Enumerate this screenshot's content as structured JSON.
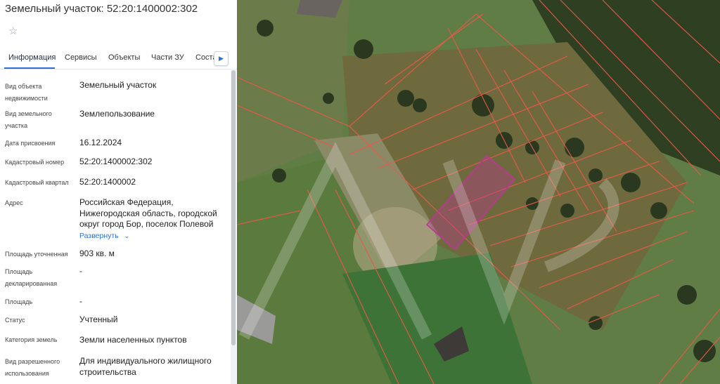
{
  "panel": {
    "title": "Земельный участок: 52:20:1400002:302",
    "tabs": [
      "Информация",
      "Сервисы",
      "Объекты",
      "Части ЗУ",
      "Соста"
    ],
    "fields": [
      {
        "label": "Вид объекта недвижимости",
        "value": "Земельный участок"
      },
      {
        "label": "Вид земельного участка",
        "value": "Землепользование"
      },
      {
        "label": "Дата присвоения",
        "value": "16.12.2024"
      },
      {
        "label": "Кадастровый номер",
        "value": "52:20:1400002:302"
      },
      {
        "label": "Кадастровый квартал",
        "value": "52:20:1400002"
      },
      {
        "label": "Адрес",
        "value": "Российская Федерация, Нижегородская область, городской округ город Бор, поселок Полевой"
      },
      {
        "label": "Площадь уточненная",
        "value": "903 кв. м"
      },
      {
        "label": "Площадь декларированная",
        "value": "-"
      },
      {
        "label": "Площадь",
        "value": "-"
      },
      {
        "label": "Статус",
        "value": "Учтенный"
      },
      {
        "label": "Категория земель",
        "value": "Земли населенных пунктов"
      },
      {
        "label": "Вид разрешенного использования",
        "value": "Для индивидуального жилищного строительства"
      }
    ],
    "expand_label": "Развернуть"
  },
  "colors": {
    "accent": "#2e6fd8",
    "parcel_boundary": "#e8594a",
    "selected_parcel": "#c0349b"
  },
  "icons": {
    "favorite": "star-icon",
    "tab_scroll": "chevron-right-icon",
    "expand": "chevron-down-icon"
  }
}
